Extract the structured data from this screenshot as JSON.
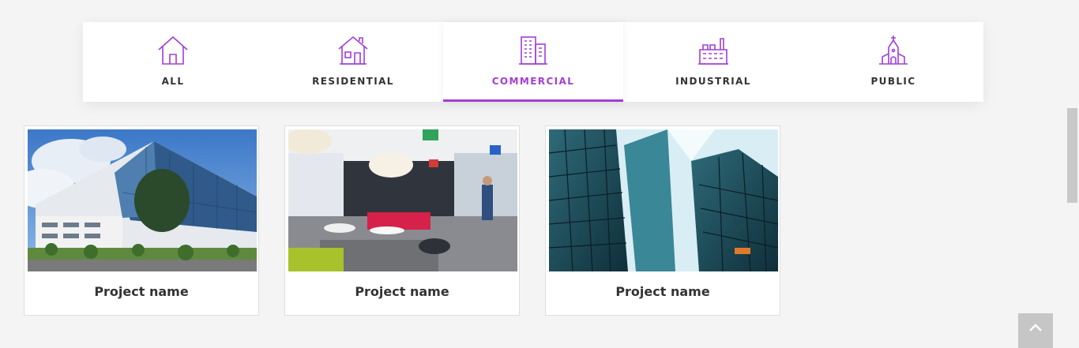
{
  "filters": {
    "accent_color": "#a23ed8",
    "active": "COMMERCIAL",
    "tabs": [
      {
        "label": "ALL",
        "icon": "house-icon"
      },
      {
        "label": "RESIDENTIAL",
        "icon": "residential-house-icon"
      },
      {
        "label": "COMMERCIAL",
        "icon": "office-building-icon"
      },
      {
        "label": "INDUSTRIAL",
        "icon": "factory-icon"
      },
      {
        "label": "PUBLIC",
        "icon": "church-icon"
      }
    ]
  },
  "projects": [
    {
      "name": "Project name",
      "image": "glass-office-building-photo"
    },
    {
      "name": "Project name",
      "image": "office-lobby-photo"
    },
    {
      "name": "Project name",
      "image": "glass-skyscraper-photo"
    }
  ],
  "back_to_top": {
    "icon": "chevron-up-icon"
  }
}
